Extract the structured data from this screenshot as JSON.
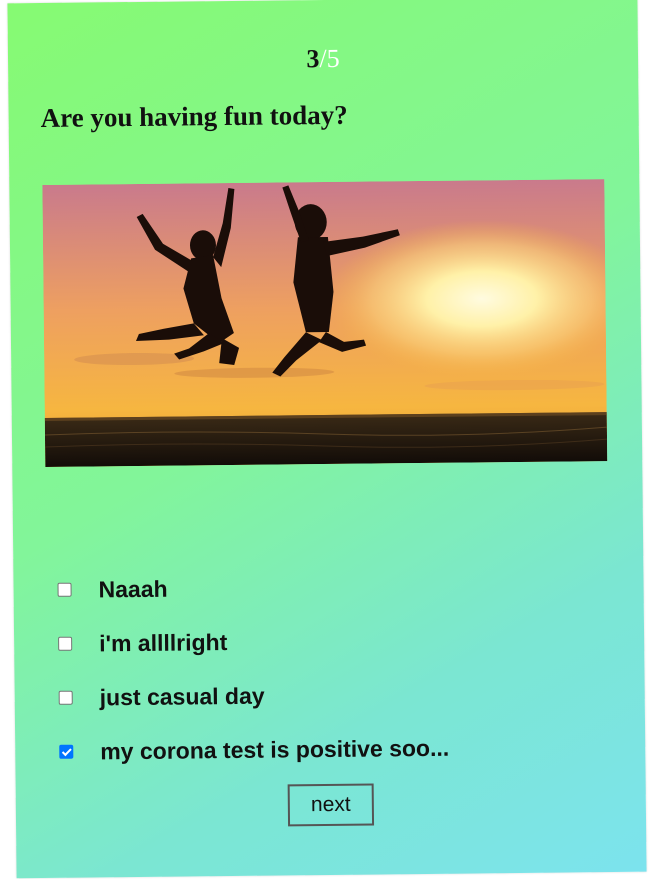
{
  "progress": {
    "current": "3",
    "separator": "/",
    "total": "5"
  },
  "question": {
    "text": "Are you having fun today?"
  },
  "image": {
    "subject": "silhouettes jumping at sunset beach",
    "sky_top": "#c97a8c",
    "sun": "#fff3b0",
    "sea": "#2a1e12"
  },
  "options": [
    {
      "label": "Naaah",
      "checked": false
    },
    {
      "label": "i'm allllright",
      "checked": false
    },
    {
      "label": "just casual day",
      "checked": false
    },
    {
      "label": "my corona test is positive soo...",
      "checked": true
    }
  ],
  "next_button": {
    "label": "next"
  },
  "colors": {
    "gradient_start": "#86fa72",
    "gradient_end": "#7ce3ee",
    "checkbox_accent": "#0075ff"
  }
}
